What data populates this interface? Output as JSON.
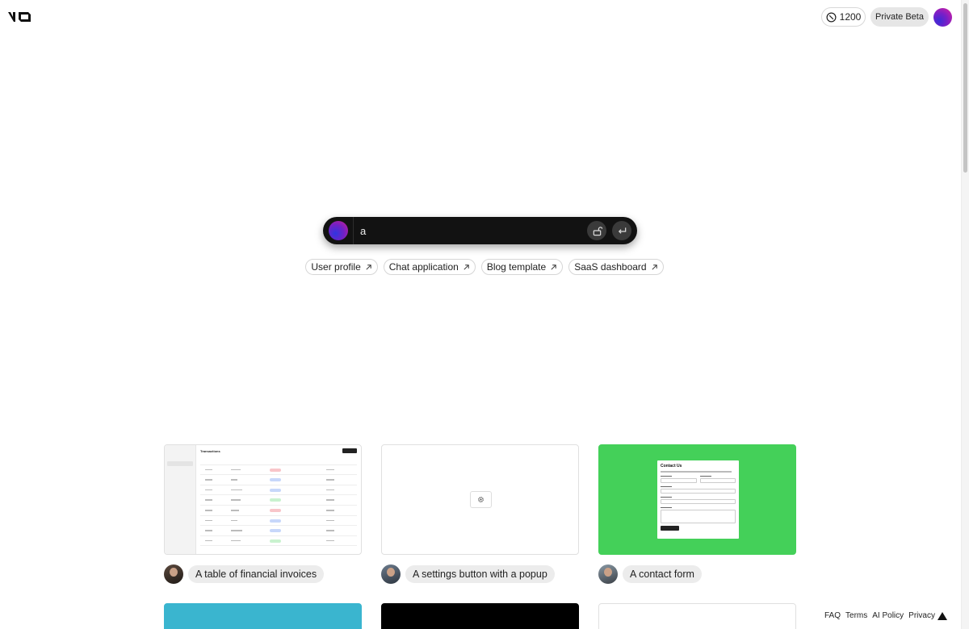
{
  "header": {
    "logo_text": "v0",
    "credits": "1200",
    "beta_label": "Private Beta"
  },
  "prompt": {
    "value": "a"
  },
  "suggestions": [
    {
      "label": "User profile"
    },
    {
      "label": "Chat application"
    },
    {
      "label": "Blog template"
    },
    {
      "label": "SaaS dashboard"
    }
  ],
  "gallery": [
    {
      "caption": "A table of financial invoices"
    },
    {
      "caption": "A settings button with a popup"
    },
    {
      "caption": "A contact form"
    }
  ],
  "preview_contact": {
    "title": "Contact Us"
  },
  "preview_table": {
    "title": "Transactions"
  },
  "footer": {
    "links": [
      "FAQ",
      "Terms",
      "AI Policy",
      "Privacy"
    ]
  },
  "colors": {
    "card_green": "#44d059",
    "card_teal": "#3ab5cf",
    "card_black": "#000000"
  }
}
